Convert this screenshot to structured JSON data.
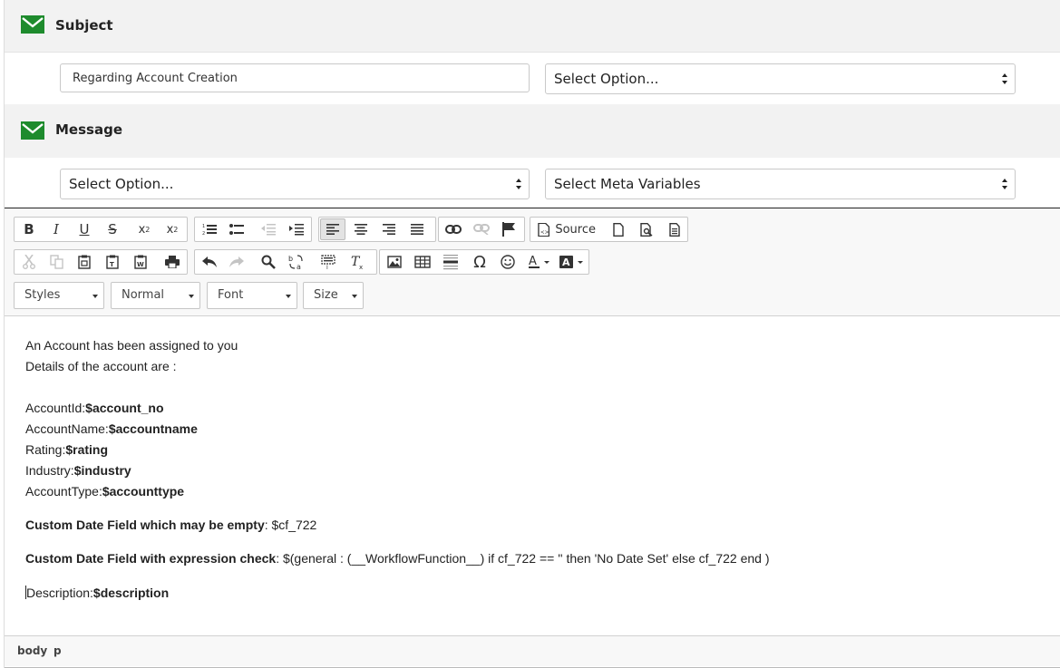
{
  "subject_section": {
    "title": "Subject",
    "icon": "mail-icon",
    "input_value": "Regarding Account Creation",
    "select_value": "Select Option..."
  },
  "message_section": {
    "title": "Message",
    "icon": "mail-icon",
    "select_option": "Select Option...",
    "select_meta": "Select Meta Variables"
  },
  "colors": {
    "accent_green": "#1e8b2d"
  },
  "toolbar": {
    "source_label": "Source",
    "combos": {
      "styles": "Styles",
      "format": "Normal",
      "font": "Font",
      "size": "Size"
    }
  },
  "content": {
    "intro1": "An Account has been assigned to you",
    "intro2": "Details of the account are :",
    "fields": [
      {
        "label": "AccountId:",
        "var": "$account_no"
      },
      {
        "label": "AccountName:",
        "var": "$accountname"
      },
      {
        "label": "Rating:",
        "var": "$rating"
      },
      {
        "label": "Industry:",
        "var": "$industry"
      },
      {
        "label": "AccountType:",
        "var": "$accounttype"
      }
    ],
    "custom1_label": "Custom Date Field which may be empty",
    "custom1_value": ": $cf_722",
    "custom2_label": "Custom Date Field with expression check",
    "custom2_value": ": $(general : (__WorkflowFunction__) if cf_722 == '' then 'No Date Set' else cf_722 end )",
    "desc_label": "Description:",
    "desc_var": "$description"
  },
  "statusbar": {
    "path1": "body",
    "path2": "p"
  }
}
